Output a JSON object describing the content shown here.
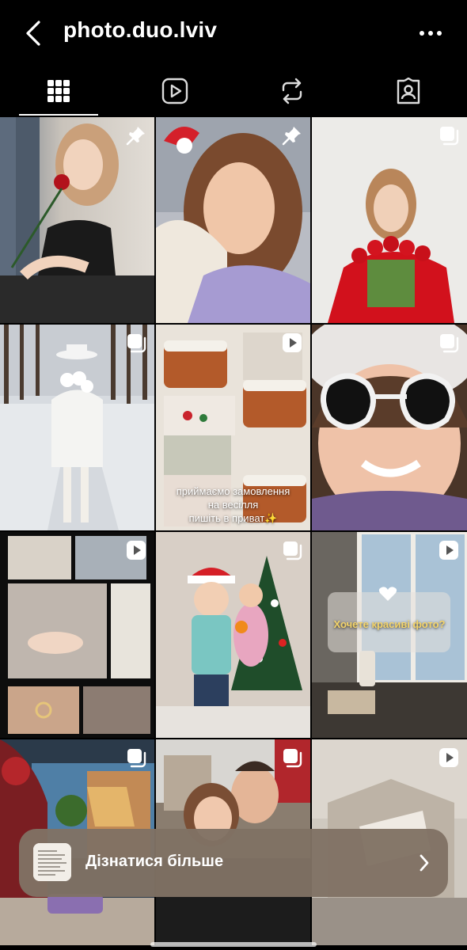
{
  "header": {
    "title": "photo.duo.lviv"
  },
  "tabs": [
    {
      "name": "posts-grid"
    },
    {
      "name": "reels"
    },
    {
      "name": "reposts"
    },
    {
      "name": "tagged"
    }
  ],
  "posts": {
    "cake_caption": "приймаємо замовлення на весілля пишіть в приват✨",
    "photo_caption": "Хочете красиві фото?"
  },
  "promo": {
    "label": "Дізнатися більше"
  },
  "colors": {
    "background": "#000000",
    "promo_background": "#807164"
  }
}
